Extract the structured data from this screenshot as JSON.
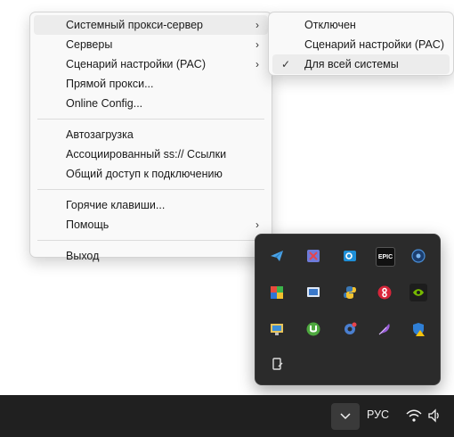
{
  "main_menu": {
    "items": [
      {
        "label": "Системный прокси-сервер",
        "has_submenu": true
      },
      {
        "label": "Серверы",
        "has_submenu": true
      },
      {
        "label": "Сценарий настройки (PAC)",
        "has_submenu": true
      },
      {
        "label": "Прямой прокси..."
      },
      {
        "label": "Online Config..."
      },
      {
        "label": "Автозагрузка"
      },
      {
        "label": "Ассоциированный ss:// Ссылки"
      },
      {
        "label": "Общий доступ к подключению"
      },
      {
        "label": "Горячие клавиши..."
      },
      {
        "label": "Помощь",
        "has_submenu": true
      },
      {
        "label": "Выход"
      }
    ]
  },
  "submenu": {
    "items": [
      {
        "label": "Отключен",
        "checked": false
      },
      {
        "label": "Сценарий настройки (PAC)",
        "checked": false
      },
      {
        "label": "Для всей системы",
        "checked": true
      }
    ]
  },
  "tray_overflow": {
    "icons": [
      "telegram-icon",
      "snipping-tool-icon",
      "outlook-icon",
      "epic-games-icon",
      "vpn-shield-icon",
      "color-app-icon",
      "remote-desktop-icon",
      "python-icon",
      "wps-icon",
      "nvidia-icon",
      "monitor-app-icon",
      "utorrent-icon",
      "gear-app-icon",
      "feather-app-icon",
      "defender-warning-icon",
      "usb-eject-icon"
    ]
  },
  "taskbar": {
    "language": "РУС"
  },
  "colors": {
    "taskbar_bg": "#202020",
    "menu_bg": "#f9f9f9",
    "tray_bg": "#2b2b2b"
  }
}
